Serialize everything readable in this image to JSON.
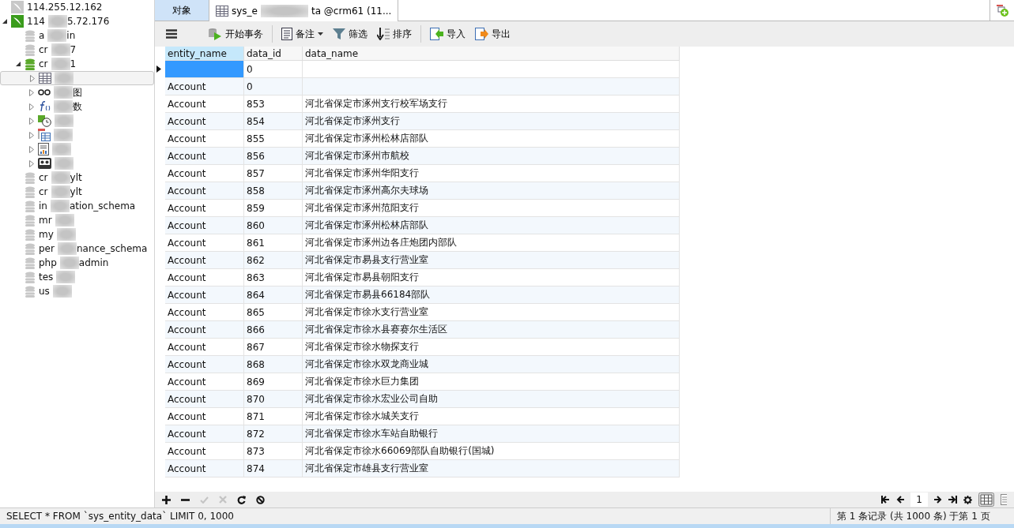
{
  "sidebar": {
    "items": [
      {
        "kind": "server",
        "active": false,
        "start": "114.255.12.162"
      },
      {
        "kind": "server",
        "active": true,
        "start": "114",
        "end": "5.72.176",
        "expanded": true,
        "children": [
          {
            "kind": "database",
            "active": false,
            "start": "a",
            "end": "in"
          },
          {
            "kind": "database",
            "active": false,
            "start": "cr",
            "end": "7"
          },
          {
            "kind": "database",
            "active": true,
            "start": "cr",
            "end": "1",
            "expanded": true,
            "children": [
              {
                "kind": "tables",
                "selected": true
              },
              {
                "kind": "views",
                "selected": false,
                "end": "图"
              },
              {
                "kind": "functions",
                "selected": false,
                "end": "数"
              },
              {
                "kind": "events",
                "selected": false
              },
              {
                "kind": "queries",
                "selected": false
              },
              {
                "kind": "reports",
                "selected": false
              },
              {
                "kind": "backups",
                "selected": false
              }
            ]
          },
          {
            "kind": "database",
            "active": false,
            "start": "cr",
            "end": "ylt"
          },
          {
            "kind": "database",
            "active": false,
            "start": "cr",
            "end": "ylt"
          },
          {
            "kind": "database",
            "active": false,
            "start": "in",
            "end": "ation_schema"
          },
          {
            "kind": "database",
            "active": false,
            "start": "mr"
          },
          {
            "kind": "database",
            "active": false,
            "start": "my"
          },
          {
            "kind": "database",
            "active": false,
            "start": "per",
            "end": "nance_schema"
          },
          {
            "kind": "database",
            "active": false,
            "start": "php",
            "end": "admin"
          },
          {
            "kind": "database",
            "active": false,
            "start": "tes"
          },
          {
            "kind": "database",
            "active": false,
            "start": "us"
          }
        ]
      }
    ]
  },
  "tabs": [
    {
      "kind": "objects",
      "label": "对象",
      "selected": false
    },
    {
      "kind": "table",
      "label_start": "sys_e",
      "label_end": "ta @crm61 (11...",
      "selected": true
    }
  ],
  "toolbar": [
    {
      "label": "开始事务"
    },
    {
      "label": "备注",
      "dropdown": true
    },
    {
      "label": "筛选"
    },
    {
      "label": "排序"
    },
    {
      "label": "导入"
    },
    {
      "label": "导出"
    }
  ],
  "table": {
    "columns": [
      {
        "label": "entity_name",
        "selected": true
      },
      {
        "label": "data_id",
        "selected": false
      },
      {
        "label": "data_name",
        "selected": false
      }
    ],
    "rows": [
      {
        "current": true,
        "cells": [
          "",
          "0",
          ""
        ]
      },
      {
        "current": false,
        "cells": [
          "Account",
          "0",
          ""
        ]
      },
      {
        "current": false,
        "cells": [
          "Account",
          "853",
          "河北省保定市涿州支行校军场支行"
        ]
      },
      {
        "current": false,
        "cells": [
          "Account",
          "854",
          "河北省保定市涿州支行"
        ]
      },
      {
        "current": false,
        "cells": [
          "Account",
          "855",
          "河北省保定市涿州松林店部队"
        ]
      },
      {
        "current": false,
        "cells": [
          "Account",
          "856",
          "河北省保定市涿州市航校"
        ]
      },
      {
        "current": false,
        "cells": [
          "Account",
          "857",
          "河北省保定市涿州华阳支行"
        ]
      },
      {
        "current": false,
        "cells": [
          "Account",
          "858",
          "河北省保定市涿州高尔夫球场"
        ]
      },
      {
        "current": false,
        "cells": [
          "Account",
          "859",
          "河北省保定市涿州范阳支行"
        ]
      },
      {
        "current": false,
        "cells": [
          "Account",
          "860",
          "河北省保定市涿州松林店部队"
        ]
      },
      {
        "current": false,
        "cells": [
          "Account",
          "861",
          "河北省保定市涿州边各庄炮团内部队"
        ]
      },
      {
        "current": false,
        "cells": [
          "Account",
          "862",
          "河北省保定市易县支行营业室"
        ]
      },
      {
        "current": false,
        "cells": [
          "Account",
          "863",
          "河北省保定市易县朝阳支行"
        ]
      },
      {
        "current": false,
        "cells": [
          "Account",
          "864",
          "河北省保定市易县66184部队"
        ]
      },
      {
        "current": false,
        "cells": [
          "Account",
          "865",
          "河北省保定市徐水支行营业室"
        ]
      },
      {
        "current": false,
        "cells": [
          "Account",
          "866",
          "河北省保定市徐水县赛赛尔生活区"
        ]
      },
      {
        "current": false,
        "cells": [
          "Account",
          "867",
          "河北省保定市徐水物探支行"
        ]
      },
      {
        "current": false,
        "cells": [
          "Account",
          "868",
          "河北省保定市徐水双龙商业城"
        ]
      },
      {
        "current": false,
        "cells": [
          "Account",
          "869",
          "河北省保定市徐水巨力集团"
        ]
      },
      {
        "current": false,
        "cells": [
          "Account",
          "870",
          "河北省保定市徐水宏业公司自助"
        ]
      },
      {
        "current": false,
        "cells": [
          "Account",
          "871",
          "河北省保定市徐水城关支行"
        ]
      },
      {
        "current": false,
        "cells": [
          "Account",
          "872",
          "河北省保定市徐水车站自助银行"
        ]
      },
      {
        "current": false,
        "cells": [
          "Account",
          "873",
          "河北省保定市徐水66069部队自助银行(国城)"
        ]
      },
      {
        "current": false,
        "cells": [
          "Account",
          "874",
          "河北省保定市雄县支行营业室"
        ]
      }
    ]
  },
  "grid_actions": [
    {
      "disabled": false
    },
    {
      "disabled": false
    },
    {
      "disabled": true
    },
    {
      "disabled": true
    },
    {
      "disabled": false
    },
    {
      "disabled": false
    }
  ],
  "pager": {
    "page": "1"
  },
  "status_bar": {
    "query": "SELECT * FROM `sys_entity_data` LIMIT 0, 1000",
    "records": "第 1 条记录 (共 1000 条) 于第 1 页"
  }
}
